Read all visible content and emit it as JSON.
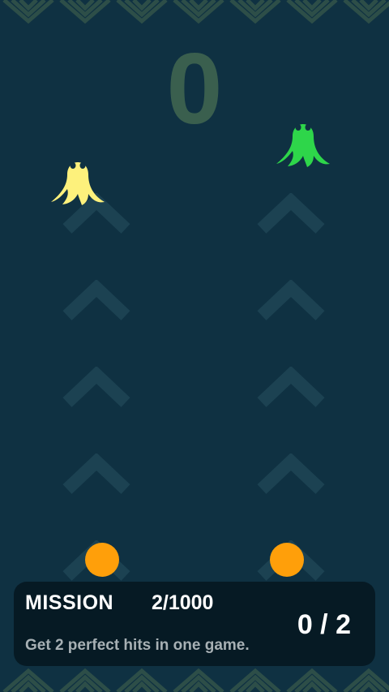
{
  "score": "0",
  "mission": {
    "title": "MISSION",
    "count": "2/1000",
    "description": "Get 2 perfect hits in one game.",
    "progress": "0 / 2"
  },
  "colors": {
    "background": "#0f3142",
    "score": "#3a5f4e",
    "ghost_left": "#fdf17c",
    "ghost_right": "#2ed64a",
    "ball": "#ff9f0a",
    "leaf": "#2d4e48",
    "panel": "#061a24"
  },
  "icons": {
    "ghost": "ghost-icon",
    "lane_arrow": "chevron-up-icon",
    "border": "leaf-pattern"
  }
}
